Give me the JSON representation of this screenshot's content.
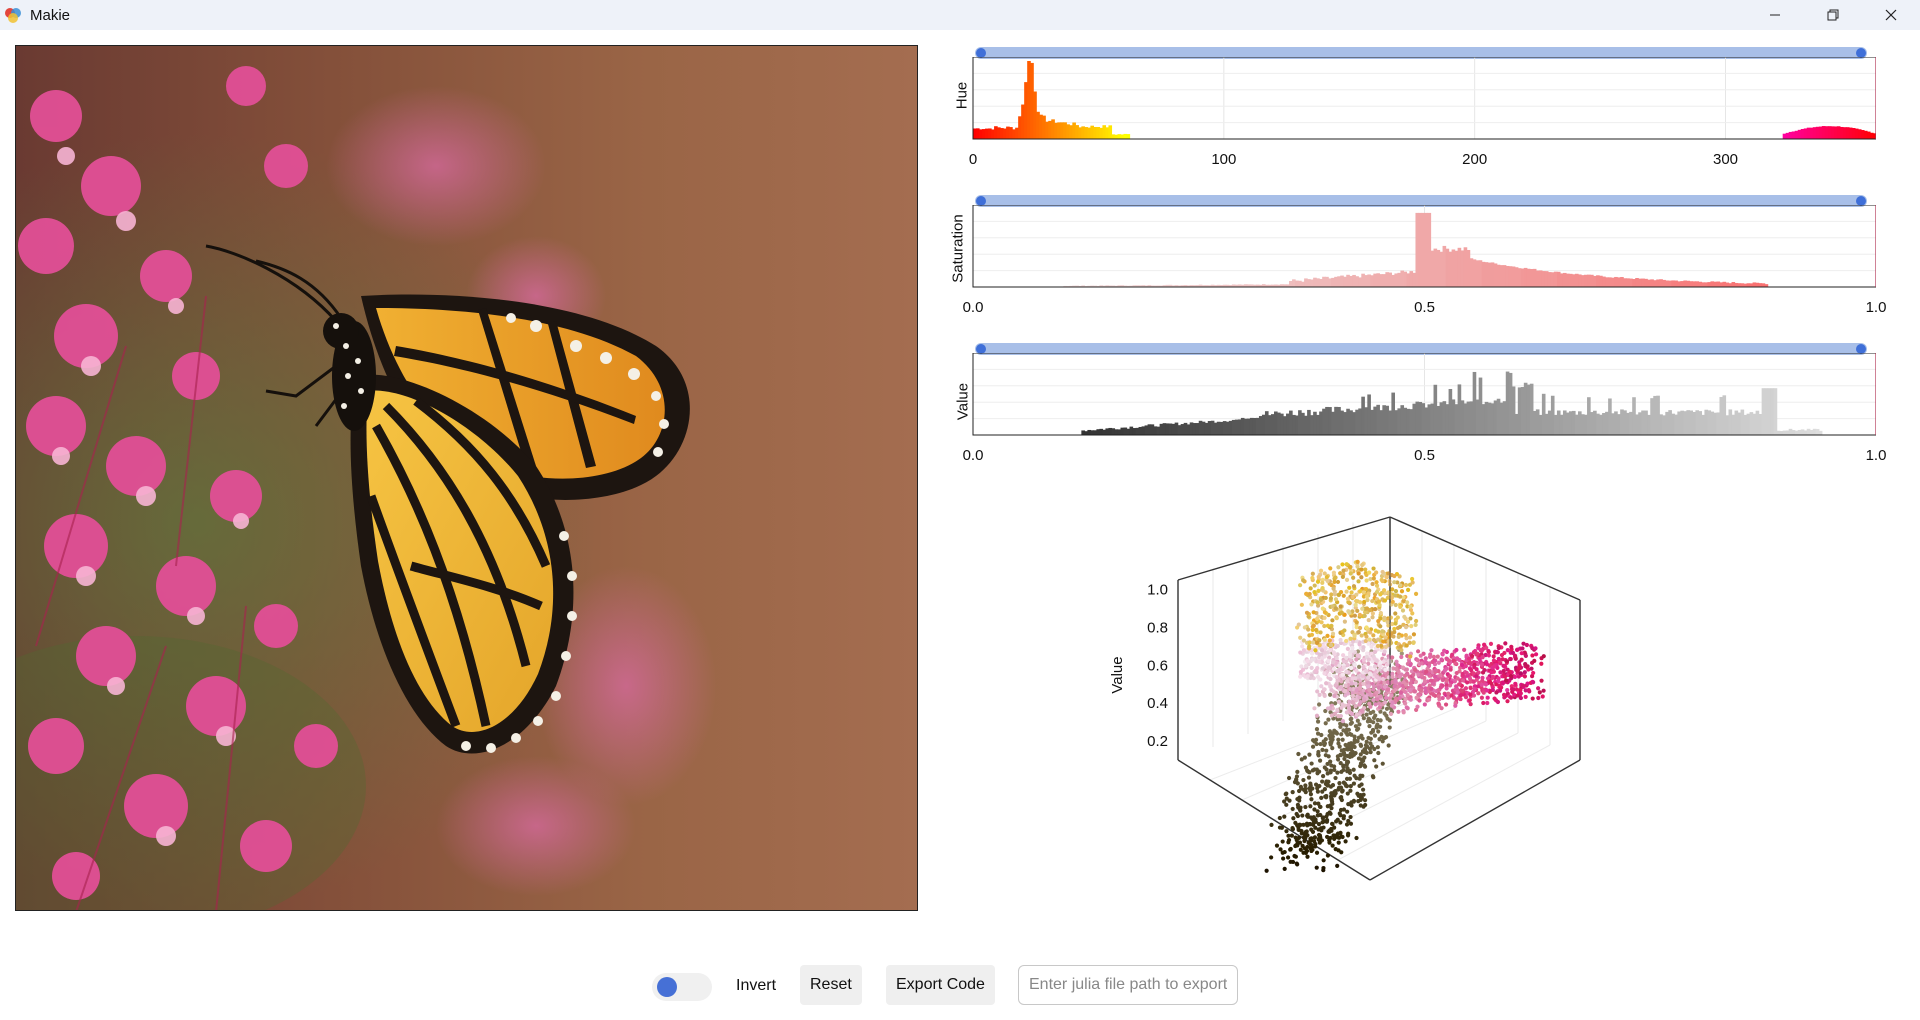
{
  "window": {
    "title": "Makie",
    "controls": [
      "minimize",
      "restore",
      "close"
    ]
  },
  "histograms": [
    {
      "id": "hue",
      "ylabel": "Hue",
      "ticks": [
        "0",
        "100",
        "200",
        "300"
      ],
      "tick_values": [
        0,
        100,
        200,
        300
      ],
      "range": [
        0,
        360
      ],
      "slider_range": [
        0,
        360
      ]
    },
    {
      "id": "saturation",
      "ylabel": "Saturation",
      "ticks": [
        "0.0",
        "0.5",
        "1.0"
      ],
      "tick_values": [
        0,
        0.5,
        1
      ],
      "range": [
        0,
        1
      ],
      "slider_range": [
        0,
        1
      ]
    },
    {
      "id": "value",
      "ylabel": "Value",
      "ticks": [
        "0.0",
        "0.5",
        "1.0"
      ],
      "tick_values": [
        0,
        0.5,
        1
      ],
      "range": [
        0,
        1
      ],
      "slider_range": [
        0,
        1
      ]
    }
  ],
  "scatter3d": {
    "zlabel": "Value",
    "zticks": [
      "1.0",
      "0.8",
      "0.6",
      "0.4",
      "0.2"
    ],
    "zrange": [
      0.1,
      1.05
    ]
  },
  "controls": {
    "invert_label": "Invert",
    "invert_on": false,
    "reset_label": "Reset",
    "export_label": "Export Code",
    "path_placeholder": "Enter julia file path to export"
  },
  "colors": {
    "slider_track": "#a8bfe8",
    "slider_knob": "#3f6fd8",
    "titlebar": "#eef2f9"
  }
}
